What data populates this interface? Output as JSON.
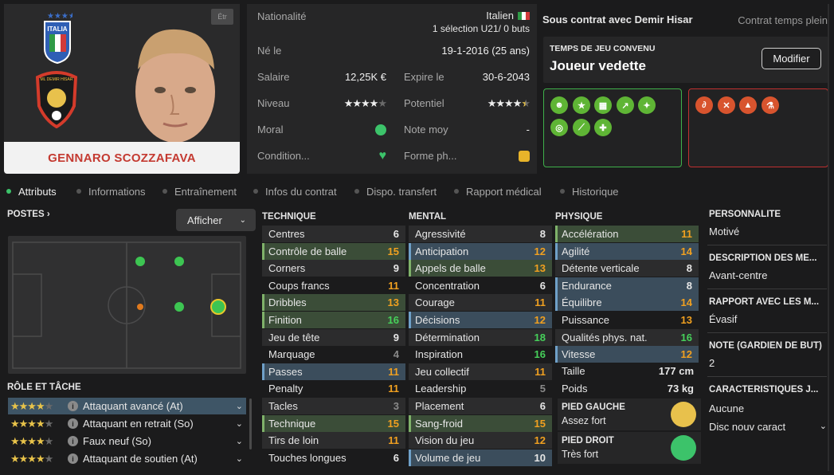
{
  "profile": {
    "name": "GENNARO SCOZZAFAVA",
    "badge": "Étr",
    "nation_crest_text": "ITALIA",
    "club_crest_text": "ML DEMIR HISAR"
  },
  "info": {
    "nationality_label": "Nationalité",
    "nationality_value": "Italien",
    "caps": "1 sélection U21/ 0 buts",
    "born_label": "Né le",
    "born_value": "19-1-2016 (25 ans)",
    "salary_label": "Salaire",
    "salary_value": "12,25K €",
    "expires_label": "Expire le",
    "expires_value": "30-6-2043",
    "level_label": "Niveau",
    "level_stars": 4,
    "potential_label": "Potentiel",
    "potential_stars": 4.5,
    "morale_label": "Moral",
    "avg_rating_label": "Note moy",
    "avg_rating_value": "-",
    "condition_label": "Condition...",
    "form_label": "Forme ph..."
  },
  "contract": {
    "club": "Sous contrat avec Demir Hisar",
    "type": "Contrat temps plein",
    "playtime_label": "TEMPS DE JEU CONVENU",
    "playtime_value": "Joueur vedette",
    "modify_label": "Modifier"
  },
  "tabs": [
    {
      "label": "Attributs",
      "active": true
    },
    {
      "label": "Informations",
      "active": false
    },
    {
      "label": "Entraînement",
      "active": false
    },
    {
      "label": "Infos du contrat",
      "active": false
    },
    {
      "label": "Dispo. transfert",
      "active": false
    },
    {
      "label": "Rapport médical",
      "active": false
    },
    {
      "label": "Historique",
      "active": false
    }
  ],
  "positions": {
    "title": "POSTES",
    "show_label": "Afficher",
    "roles_title": "RÔLE ET TÂCHE",
    "roles": [
      {
        "name": "Attaquant avancé (At)",
        "stars": 4,
        "selected": true
      },
      {
        "name": "Attaquant en retrait (So)",
        "stars": 4,
        "selected": false
      },
      {
        "name": "Faux neuf (So)",
        "stars": 4,
        "selected": false
      },
      {
        "name": "Attaquant de soutien (At)",
        "stars": 4,
        "selected": false
      }
    ]
  },
  "technique": {
    "title": "TECHNIQUE",
    "attrs": [
      {
        "name": "Centres",
        "value": "6",
        "color": "white",
        "hl": ""
      },
      {
        "name": "Contrôle de balle",
        "value": "15",
        "color": "orange",
        "hl": "g"
      },
      {
        "name": "Corners",
        "value": "9",
        "color": "white",
        "hl": ""
      },
      {
        "name": "Coups francs",
        "value": "11",
        "color": "orange",
        "hl": ""
      },
      {
        "name": "Dribbles",
        "value": "13",
        "color": "orange",
        "hl": "g"
      },
      {
        "name": "Finition",
        "value": "16",
        "color": "green",
        "hl": "g"
      },
      {
        "name": "Jeu de tête",
        "value": "9",
        "color": "white",
        "hl": ""
      },
      {
        "name": "Marquage",
        "value": "4",
        "color": "gray",
        "hl": ""
      },
      {
        "name": "Passes",
        "value": "11",
        "color": "orange",
        "hl": "b"
      },
      {
        "name": "Penalty",
        "value": "11",
        "color": "orange",
        "hl": ""
      },
      {
        "name": "Tacles",
        "value": "3",
        "color": "gray",
        "hl": ""
      },
      {
        "name": "Technique",
        "value": "15",
        "color": "orange",
        "hl": "g"
      },
      {
        "name": "Tirs de loin",
        "value": "11",
        "color": "orange",
        "hl": ""
      },
      {
        "name": "Touches longues",
        "value": "6",
        "color": "white",
        "hl": ""
      }
    ]
  },
  "mental": {
    "title": "MENTAL",
    "attrs": [
      {
        "name": "Agressivité",
        "value": "8",
        "color": "white",
        "hl": ""
      },
      {
        "name": "Anticipation",
        "value": "12",
        "color": "orange",
        "hl": "b"
      },
      {
        "name": "Appels de balle",
        "value": "13",
        "color": "orange",
        "hl": "g"
      },
      {
        "name": "Concentration",
        "value": "6",
        "color": "white",
        "hl": ""
      },
      {
        "name": "Courage",
        "value": "11",
        "color": "orange",
        "hl": ""
      },
      {
        "name": "Décisions",
        "value": "12",
        "color": "orange",
        "hl": "b"
      },
      {
        "name": "Détermination",
        "value": "18",
        "color": "green",
        "hl": ""
      },
      {
        "name": "Inspiration",
        "value": "16",
        "color": "green",
        "hl": ""
      },
      {
        "name": "Jeu collectif",
        "value": "11",
        "color": "orange",
        "hl": ""
      },
      {
        "name": "Leadership",
        "value": "5",
        "color": "gray",
        "hl": ""
      },
      {
        "name": "Placement",
        "value": "6",
        "color": "white",
        "hl": ""
      },
      {
        "name": "Sang-froid",
        "value": "15",
        "color": "orange",
        "hl": "g"
      },
      {
        "name": "Vision du jeu",
        "value": "12",
        "color": "orange",
        "hl": ""
      },
      {
        "name": "Volume de jeu",
        "value": "10",
        "color": "white",
        "hl": "b"
      }
    ]
  },
  "physique": {
    "title": "PHYSIQUE",
    "attrs": [
      {
        "name": "Accélération",
        "value": "11",
        "color": "orange",
        "hl": "g"
      },
      {
        "name": "Agilité",
        "value": "14",
        "color": "orange",
        "hl": "b"
      },
      {
        "name": "Détente verticale",
        "value": "8",
        "color": "white",
        "hl": ""
      },
      {
        "name": "Endurance",
        "value": "8",
        "color": "white",
        "hl": "b"
      },
      {
        "name": "Équilibre",
        "value": "14",
        "color": "orange",
        "hl": "b"
      },
      {
        "name": "Puissance",
        "value": "13",
        "color": "orange",
        "hl": ""
      },
      {
        "name": "Qualités phys. nat.",
        "value": "16",
        "color": "green",
        "hl": ""
      },
      {
        "name": "Vitesse",
        "value": "12",
        "color": "orange",
        "hl": "b"
      }
    ],
    "height_label": "Taille",
    "height_value": "177 cm",
    "weight_label": "Poids",
    "weight_value": "73 kg",
    "left_foot_label": "PIED GAUCHE",
    "left_foot_value": "Assez fort",
    "right_foot_label": "PIED DROIT",
    "right_foot_value": "Très fort"
  },
  "personality": [
    {
      "title": "PERSONNALITÉ",
      "value": "Motivé"
    },
    {
      "title": "DESCRIPTION DES MÉ...",
      "value": "Avant-centre"
    },
    {
      "title": "RAPPORT AVEC LES M...",
      "value": "Évasif"
    },
    {
      "title": "NOTE (GARDIEN DE BUT)",
      "value": "2"
    },
    {
      "title": "CARACTÉRISTIQUES J...",
      "value": "Aucune",
      "extra": "Disc nouv caract"
    }
  ],
  "colors": {
    "accent_green": "#46d05a",
    "accent_orange": "#f0a020",
    "name_red": "#c43a31",
    "good_trait": "#5fb535",
    "bad_trait": "#d8542e"
  }
}
